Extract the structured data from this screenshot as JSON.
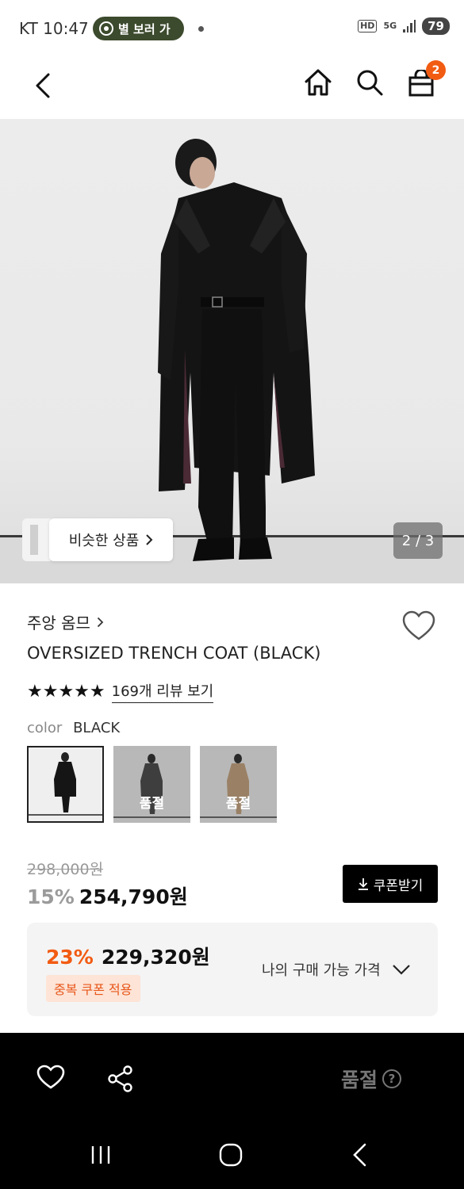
{
  "status_bar": {
    "time": "KT 10:47",
    "notification_pill": "별 보러 가",
    "icon_hd": "HD",
    "icon_network": "5G",
    "battery": "79"
  },
  "header": {
    "cart_count": "2"
  },
  "hero": {
    "similar_label": "비슷한 상품",
    "page_indicator": "2 / 3"
  },
  "product": {
    "brand": "주앙 옴므",
    "title": "OVERSIZED TRENCH COAT (BLACK)",
    "stars": "★★★★★",
    "rating": 5,
    "review_link": "169개 리뷰 보기",
    "color_key": "color",
    "color_value": "BLACK",
    "swatches": [
      {
        "name": "black",
        "soldout_label": ""
      },
      {
        "name": "charcoal",
        "soldout_label": "품절"
      },
      {
        "name": "beige",
        "soldout_label": "품절"
      }
    ]
  },
  "price": {
    "original": "298,000원",
    "discount": "15%",
    "sale": "254,790원",
    "coupon_button": "쿠폰받기"
  },
  "my_price": {
    "discount": "23%",
    "price": "229,320원",
    "badge": "중복 쿠폰 적용",
    "label": "나의 구매 가능 가격"
  },
  "action_bar": {
    "soldout_label": "품절",
    "help_glyph": "?"
  },
  "colors": {
    "accent": "#f25b12",
    "dark": "#000000"
  }
}
